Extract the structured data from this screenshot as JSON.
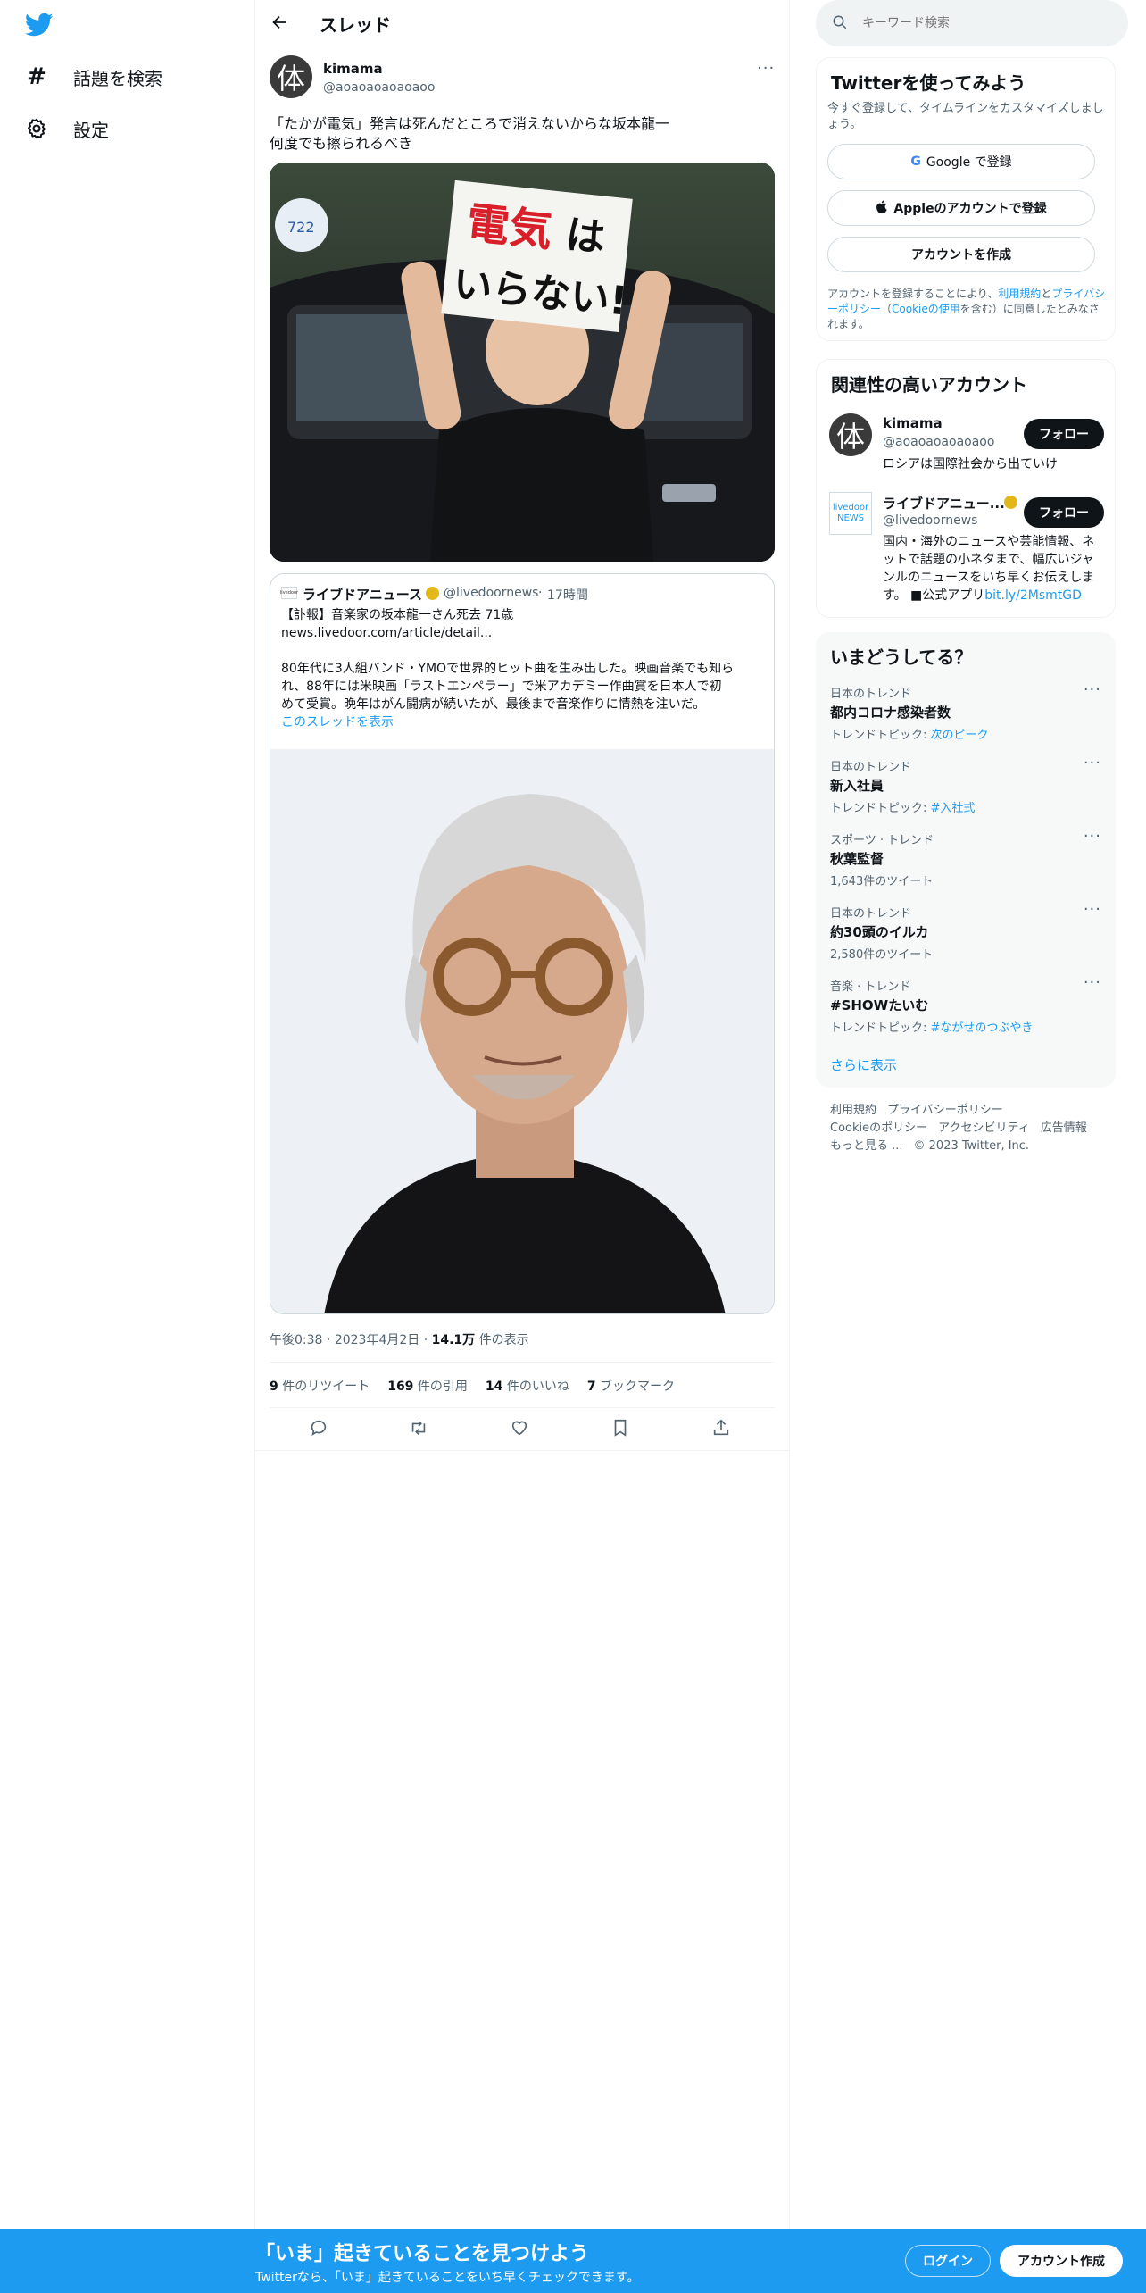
{
  "colors": {
    "brand": "#1d9bf0",
    "verified_gold": "#e2b719",
    "dark_button": "#0f1419"
  },
  "nav": {
    "logo_icon": "twitter-bird-icon",
    "items": [
      {
        "icon": "hashtag-icon",
        "label": "話題を検索"
      },
      {
        "icon": "gear-icon",
        "label": "設定"
      }
    ]
  },
  "header": {
    "back_icon": "back-arrow-icon",
    "title": "スレッド"
  },
  "tweet": {
    "avatar_char": "体",
    "name": "kimama",
    "handle": "@aoaoaoaoaoaoo",
    "more_icon": "more-dots-icon",
    "text_line1": "「たかが電気」発言は死んだところで消えないからな坂本龍一",
    "text_line2": "何度でも擦られるべき",
    "image_alt": "電気はいらない！",
    "quote": {
      "logo_text": "livedoor",
      "name": "ライブドアニュース",
      "handle": "@livedoornews",
      "dot": "·",
      "time": "17時間",
      "line1": "【訃報】音楽家の坂本龍一さん死去 71歳",
      "line2": "news.livedoor.com/article/detail...",
      "line3": "80年代に3人組バンド・YMOで世界的ヒット曲を生み出した。映画音楽でも知ら",
      "line4": "れ、88年には米映画「ラストエンペラー」で米アカデミー作曲賞を日本人で初",
      "line5": "めて受賞。晩年はがん闘病が続いたが、最後まで音楽作りに情熱を注いだ。",
      "show_thread": "このスレッドを表示"
    },
    "meta": {
      "time": "午後0:38",
      "sep": "·",
      "date": "2023年4月2日",
      "views_num": "14.1万",
      "views_label": "件の表示"
    },
    "stats": [
      {
        "num": "9",
        "label": "件のリツイート"
      },
      {
        "num": "169",
        "label": "件の引用"
      },
      {
        "num": "14",
        "label": "件のいいね"
      },
      {
        "num": "7",
        "label": "ブックマーク"
      }
    ],
    "actions": [
      "reply-icon",
      "retweet-icon",
      "like-icon",
      "bookmark-icon",
      "share-icon"
    ]
  },
  "search": {
    "placeholder": "キーワード検索"
  },
  "signup": {
    "title": "Twitterを使ってみよう",
    "subtitle": "今すぐ登録して、タイムラインをカスタマイズしましょう。",
    "google_btn": "Google で登録",
    "apple_btn": "Appleのアカウントで登録",
    "create_btn": "アカウントを作成",
    "legal_prefix": "アカウントを登録することにより、",
    "legal_terms": "利用規約",
    "legal_and": "と",
    "legal_privacy": "プライバシーポリシー",
    "legal_open": "（",
    "legal_cookie": "Cookieの使用",
    "legal_suffix": "を含む）に同意したとみなされます。"
  },
  "related": {
    "title": "関連性の高いアカウント",
    "accounts": [
      {
        "avatar_char": "体",
        "name": "kimama",
        "handle": "@aoaoaoaoaoaoo",
        "bio": "ロシアは国際社会から出ていけ",
        "follow": "フォロー"
      },
      {
        "avatar_char": "livedoor NEWS",
        "name": "ライブドアニュー...",
        "handle": "@livedoornews",
        "bio": "国内・海外のニュースや芸能情報、ネットで話題の小ネタまで、幅広いジャンルのニュースをいち早くお伝えします。 ■公式アプリ",
        "bio_link": "bit.ly/2MsmtGD",
        "follow": "フォロー"
      }
    ]
  },
  "trends": {
    "title": "いまどうしてる？",
    "items": [
      {
        "category": "日本のトレンド",
        "name": "都内コロナ感染者数",
        "sub_label": "トレンドトピック: ",
        "sub_link": "次のピーク"
      },
      {
        "category": "日本のトレンド",
        "name": "新入社員",
        "sub_label": "トレンドトピック: ",
        "sub_link": "#入社式"
      },
      {
        "category": "スポーツ · トレンド",
        "name": "秋葉監督",
        "sub_label": "1,643件のツイート",
        "sub_link": ""
      },
      {
        "category": "日本のトレンド",
        "name": "約30頭のイルカ",
        "sub_label": "2,580件のツイート",
        "sub_link": ""
      },
      {
        "category": "音楽 · トレンド",
        "name": "#SHOWたいむ",
        "sub_label": "トレンドトピック: ",
        "sub_link": "#ながせのつぶやき"
      }
    ],
    "show_more": "さらに表示"
  },
  "footer": {
    "links_row1": [
      "利用規約",
      "プライバシーポリシー"
    ],
    "links_row2": [
      "Cookieのポリシー",
      "アクセシビリティ",
      "広告情報"
    ],
    "more": "もっと見る ...",
    "copyright": "© 2023 Twitter, Inc."
  },
  "banner": {
    "title": "「いま」起きていることを見つけよう",
    "subtitle": "Twitterなら、「いま」起きていることをいち早くチェックできます。",
    "login": "ログイン",
    "signup": "アカウント作成"
  }
}
